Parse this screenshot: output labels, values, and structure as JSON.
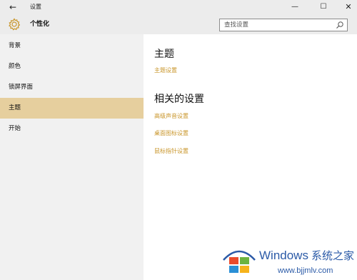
{
  "window": {
    "title": "设置",
    "back_glyph": "←",
    "min_glyph": "—",
    "max_glyph": "☐",
    "close_glyph": "✕"
  },
  "header": {
    "title": "个性化",
    "icon": "gear-icon"
  },
  "search": {
    "placeholder": "查找设置",
    "icon": "search-icon"
  },
  "sidebar": {
    "items": [
      {
        "label": "背景"
      },
      {
        "label": "颜色"
      },
      {
        "label": "锁屏界面"
      },
      {
        "label": "主题",
        "active": true
      },
      {
        "label": "开始"
      }
    ]
  },
  "main": {
    "section1_title": "主题",
    "section1_link": "主题设置",
    "section2_title": "相关的设置",
    "links": [
      "高级声音设置",
      "桌面图标设置",
      "鼠标指针设置"
    ]
  },
  "watermark": {
    "brand": "Windows",
    "cn": "系统之家",
    "url": "www.bjjmlv.com"
  },
  "colors": {
    "accent": "#c9962b",
    "active_bg": "#e6cf9e",
    "sidebar_bg": "#f1f1f1",
    "titlebar_bg": "#ececec",
    "watermark_blue": "#2b5aa7"
  }
}
